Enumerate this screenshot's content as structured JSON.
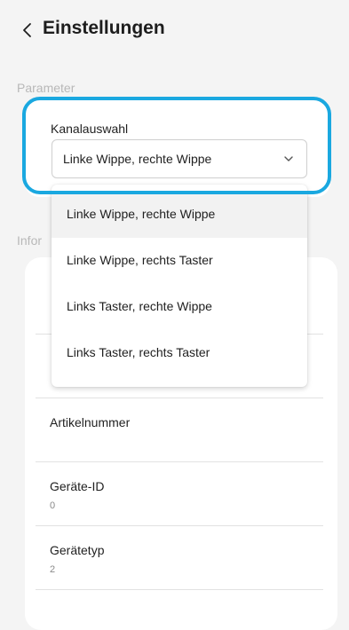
{
  "header": {
    "title": "Einstellungen",
    "back_icon": "chevron-left-icon"
  },
  "parameters": {
    "section_label": "Parameter",
    "channel_select": {
      "label": "Kanalauswahl",
      "value": "Linke Wippe, rechte Wippe",
      "chevron_icon": "chevron-down-icon",
      "options": [
        "Linke Wippe, rechte Wippe",
        "Linke Wippe, rechts Taster",
        "Links Taster, rechte Wippe",
        "Links Taster, rechts Taster"
      ],
      "selected_index": 0
    }
  },
  "info": {
    "section_label": "Infor",
    "rows": [
      {
        "label": "Artikelnummer",
        "value": ""
      },
      {
        "label": "Geräte-ID",
        "value": "0"
      },
      {
        "label": "Gerätetyp",
        "value": "2"
      }
    ]
  },
  "colors": {
    "highlight": "#1aa8e0",
    "background": "#f4f4f4",
    "card": "#ffffff"
  }
}
